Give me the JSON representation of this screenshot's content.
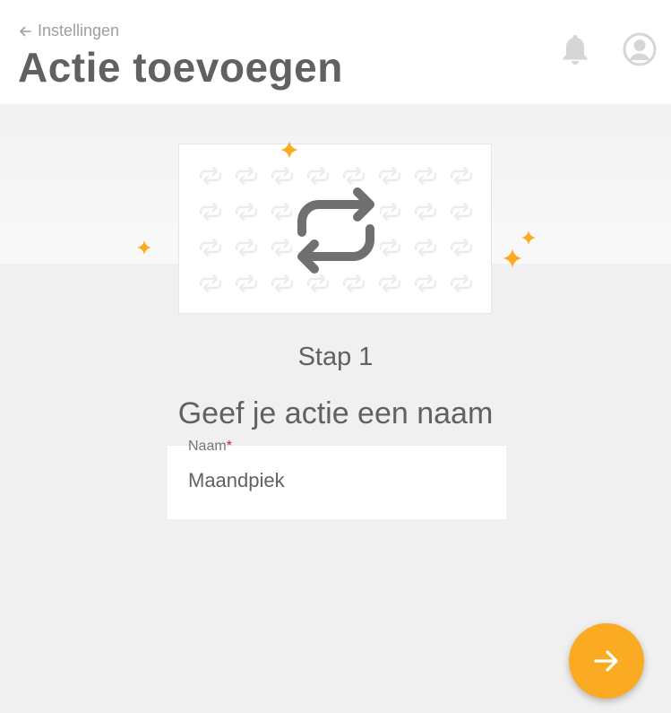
{
  "header": {
    "back_label": "Instellingen",
    "title": "Actie toevoegen"
  },
  "icons": {
    "back": "arrow-left-icon",
    "notifications": "bell-icon",
    "account": "user-circle-icon",
    "illustration": "repeat-icon",
    "next": "arrow-right-icon"
  },
  "main": {
    "step": "Stap 1",
    "question": "Geef je actie een naam",
    "name_field": {
      "label": "Naam",
      "required_mark": "*",
      "value": "Maandpiek"
    }
  },
  "colors": {
    "accent": "#fbab21",
    "text": "#616161",
    "required": "#c62828",
    "background": "#f0f0f0"
  }
}
